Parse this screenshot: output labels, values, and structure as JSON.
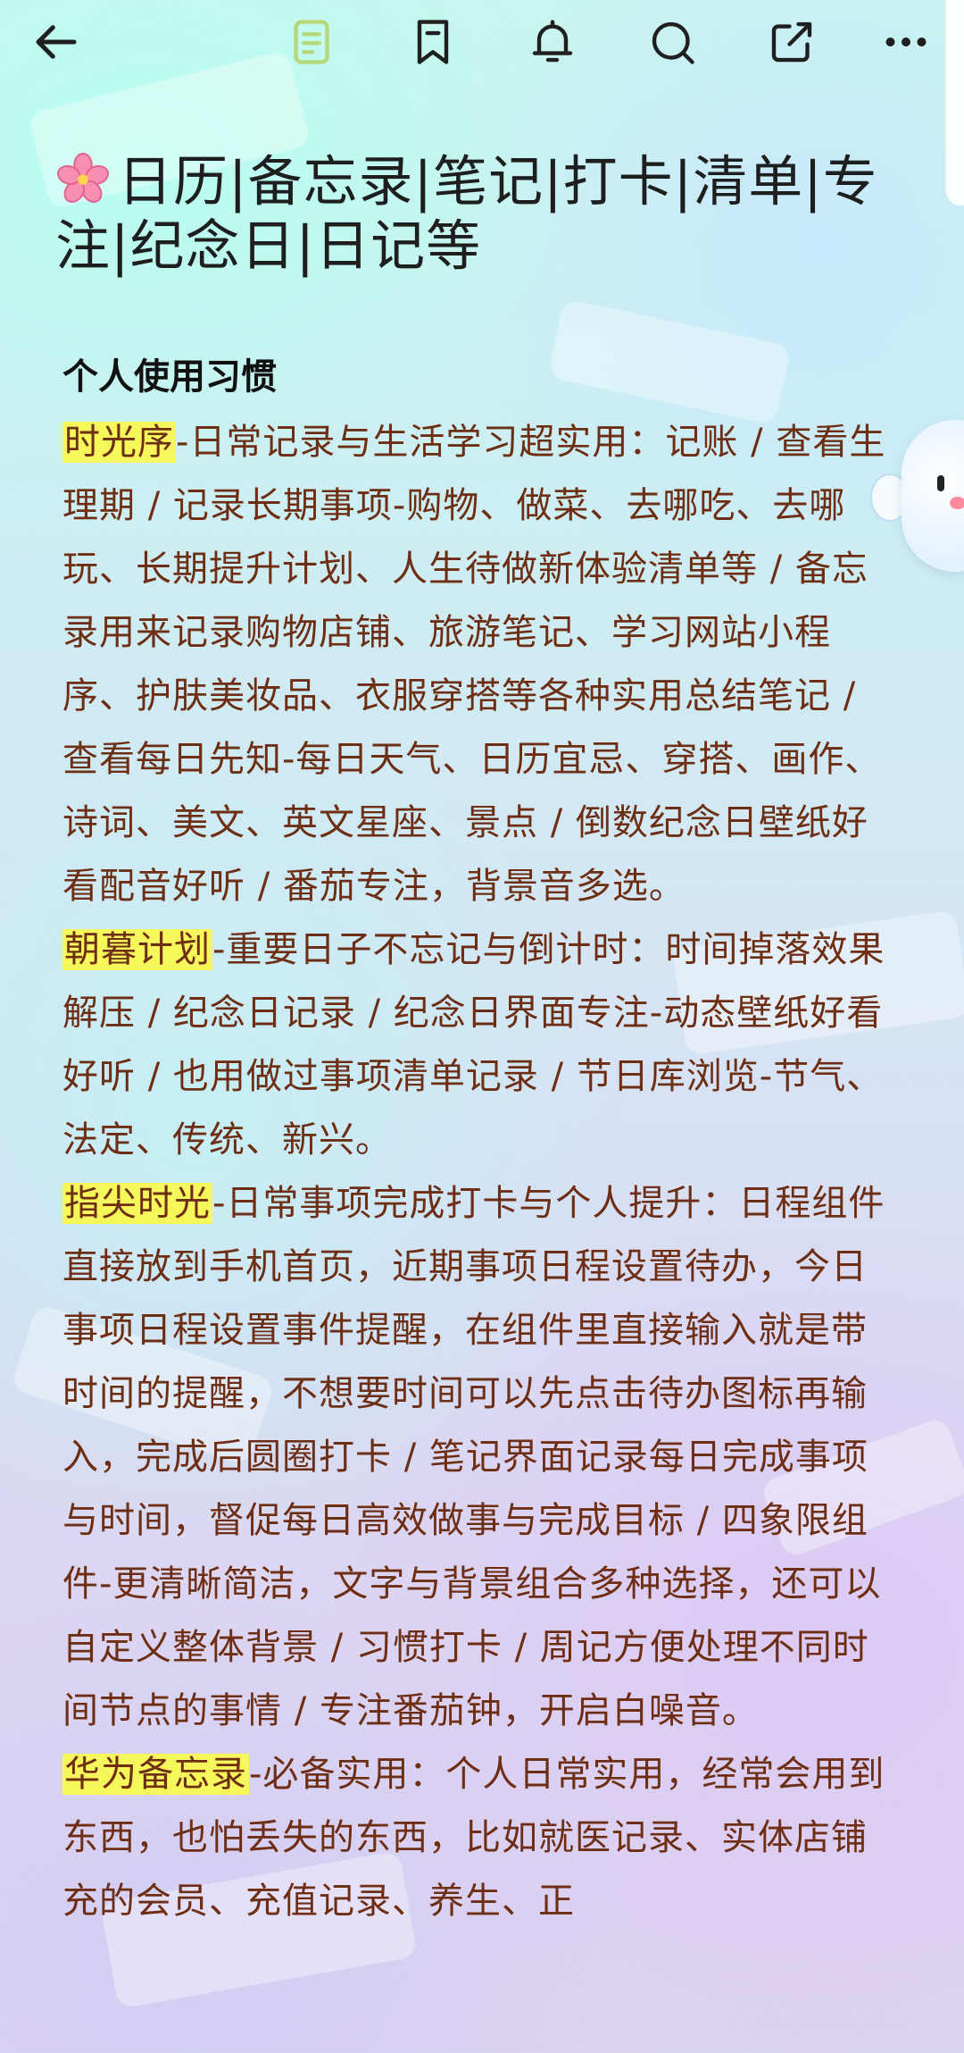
{
  "toolbar": {
    "icons": [
      "back-arrow-icon",
      "note-icon",
      "bookmark-icon",
      "bell-icon",
      "search-icon",
      "share-icon",
      "more-icon"
    ]
  },
  "post": {
    "title": "日历|备忘录|笔记|打卡|清单|专注|纪念日|日记等",
    "section_heading": "个人使用习惯",
    "sections": [
      {
        "highlight": "时光序",
        "text": "-日常记录与生活学习超实用：记账 / 查看生理期 / 记录长期事项-购物、做菜、去哪吃、去哪玩、长期提升计划、人生待做新体验清单等 / 备忘录用来记录购物店铺、旅游笔记、学习网站小程序、护肤美妆品、衣服穿搭等各种实用总结笔记 / 查看每日先知-每日天气、日历宜忌、穿搭、画作、诗词、美文、英文星座、景点 / 倒数纪念日壁纸好看配音好听 / 番茄专注，背景音多选。"
      },
      {
        "highlight": "朝暮计划",
        "text": "-重要日子不忘记与倒计时：时间掉落效果解压 / 纪念日记录 / 纪念日界面专注-动态壁纸好看好听 / 也用做过事项清单记录 / 节日库浏览-节气、法定、传统、新兴。"
      },
      {
        "highlight": "指尖时光",
        "text": "-日常事项完成打卡与个人提升：日程组件直接放到手机首页，近期事项日程设置待办，今日事项日程设置事件提醒，在组件里直接输入就是带时间的提醒，不想要时间可以先点击待办图标再输入，完成后圆圈打卡 / 笔记界面记录每日完成事项与时间，督促每日高效做事与完成目标 / 四象限组件-更清晰简洁，文字与背景组合多种选择，还可以自定义整体背景 / 习惯打卡 / 周记方便处理不同时间节点的事情 / 专注番茄钟，开启白噪音。"
      },
      {
        "highlight": "华为备忘录",
        "text": "-必备实用：个人日常实用，经常会用到东西，也怕丢失的东西，比如就医记录、实体店铺充的会员、充值记录、养生、正"
      }
    ]
  },
  "colors": {
    "highlight": "#f5f75a",
    "body_text": "#6e2e14",
    "title_text": "#1e1e1e",
    "note_icon_accent": "#b6d77a"
  }
}
